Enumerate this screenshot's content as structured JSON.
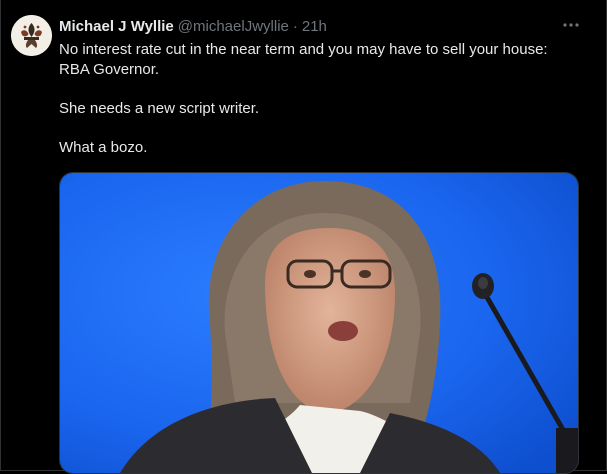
{
  "tweet": {
    "author_name": "Michael J Wyllie",
    "handle": "@michaelJwyllie",
    "separator": "·",
    "time": "21h",
    "text_lines": [
      "No interest rate cut in the near term and you may have to sell your house:",
      "RBA Governor.",
      "",
      "She needs a new script writer.",
      "",
      "What a bozo."
    ]
  },
  "icons": {
    "more": "more-horizontal-icon",
    "avatar": "fleur-de-lis-avatar"
  },
  "colors": {
    "background": "#000000",
    "text_primary": "#e7e9ea",
    "text_secondary": "#71767b",
    "photo_backdrop": "#1f6ff2"
  }
}
